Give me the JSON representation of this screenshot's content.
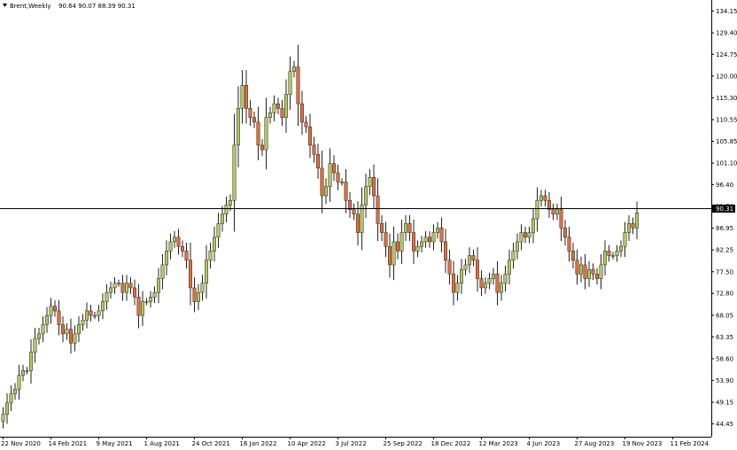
{
  "header": {
    "symbol_timeframe": "Brent,Weekly",
    "ohlc": "90.64 90.07 88.39 90.31"
  },
  "current_price_label": "90.31",
  "colors": {
    "up": "#b5c95e",
    "down": "#e2703a",
    "wick": "#222222",
    "hline": "#000000",
    "badge": "#000000"
  },
  "chart_data": {
    "type": "candlestick",
    "title": "",
    "xlabel": "",
    "ylabel": "",
    "ylim": [
      43.0,
      135.0
    ],
    "horizontal_line": 91.3,
    "y_ticks": [
      "134.15",
      "129.40",
      "124.75",
      "120.00",
      "115.30",
      "110.55",
      "105.85",
      "101.10",
      "96.40",
      "91.70",
      "86.95",
      "82.25",
      "77.50",
      "72.80",
      "68.05",
      "63.35",
      "58.60",
      "53.90",
      "49.15",
      "44.45"
    ],
    "x_ticks": [
      "22 Nov 2020",
      "14 Feb 2021",
      "9 May 2021",
      "1 Aug 2021",
      "24 Oct 2021",
      "16 Jan 2022",
      "10 Apr 2022",
      "3 Jul 2022",
      "25 Sep 2022",
      "18 Dec 2022",
      "12 Mar 2023",
      "4 Jun 2023",
      "27 Aug 2023",
      "19 Nov 2023",
      "11 Feb 2024"
    ],
    "x_tick_index": [
      0,
      12,
      24,
      36,
      48,
      60,
      72,
      84,
      96,
      108,
      120,
      132,
      144,
      156,
      168
    ],
    "close_series": [
      46.5,
      49,
      51,
      52,
      55,
      56,
      56,
      60,
      63,
      64,
      66,
      68,
      70,
      69,
      66,
      64,
      65,
      62,
      64,
      66,
      67,
      69,
      68,
      68,
      69,
      71,
      73,
      74,
      75,
      75,
      73,
      75,
      74,
      72,
      68,
      71,
      71,
      72,
      73,
      76,
      79,
      82,
      84,
      85,
      83,
      82,
      80,
      74,
      71,
      73,
      75,
      80,
      82,
      85,
      88,
      90,
      92,
      93,
      105,
      113,
      118,
      113,
      111,
      110,
      105,
      104,
      111,
      112,
      114,
      113,
      111,
      116,
      121,
      122,
      114,
      110,
      109,
      105,
      103,
      100,
      94,
      96,
      101,
      99,
      97,
      97,
      93,
      91,
      90,
      86,
      92,
      96,
      98,
      94,
      88,
      86,
      83,
      79,
      84,
      82,
      86,
      88,
      86,
      82,
      83,
      84,
      85,
      84,
      86,
      87,
      84,
      80,
      77,
      73,
      75,
      78,
      79,
      81,
      80,
      76,
      74,
      75,
      76,
      77,
      73,
      75,
      77,
      80,
      82,
      84,
      86,
      85,
      86,
      89,
      93,
      94,
      93,
      91,
      90,
      91,
      87,
      85,
      82,
      80,
      77,
      79,
      76,
      78,
      77,
      76,
      79,
      82,
      81,
      81,
      82,
      83,
      86,
      88,
      87,
      90.3
    ]
  }
}
